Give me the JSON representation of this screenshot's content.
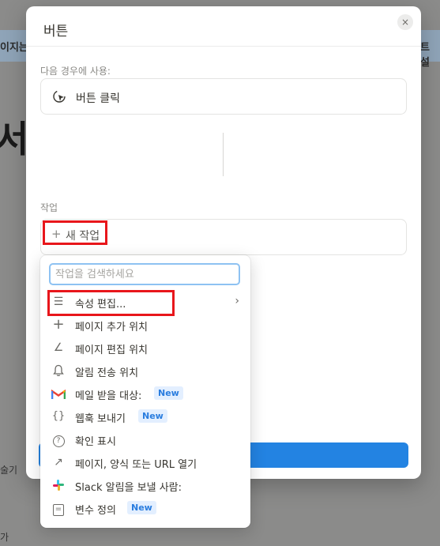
{
  "background": {
    "left_partial": "이지는",
    "right_partial": "트 설",
    "big_char": "서",
    "lower_left_partial": "술기",
    "bottom_left_partial": "가"
  },
  "modal": {
    "title": "버튼",
    "close_glyph": "×",
    "trigger_label": "다음 경우에 사용:",
    "trigger_value": "버튼 클릭",
    "action_label": "작업",
    "new_action_plus": "+",
    "new_action_label": "새 작업"
  },
  "dropdown": {
    "search_placeholder": "작업을 검색하세요",
    "items": [
      {
        "label": "속성 편집...",
        "icon": "list-icon",
        "glyph": "☰",
        "has_submenu": true,
        "badge": ""
      },
      {
        "label": "페이지 추가 위치",
        "icon": "plus-icon",
        "glyph": "+",
        "has_submenu": false,
        "badge": ""
      },
      {
        "label": "페이지 편집 위치",
        "icon": "edit-angle-icon",
        "glyph": "∠",
        "has_submenu": false,
        "badge": ""
      },
      {
        "label": "알림 전송 위치",
        "icon": "bell-icon",
        "glyph": "🔔︎",
        "has_submenu": false,
        "badge": ""
      },
      {
        "label": "메일 받을 대상:",
        "icon": "gmail-icon",
        "glyph": "M",
        "has_submenu": false,
        "badge": "New"
      },
      {
        "label": "웹훅 보내기",
        "icon": "braces-icon",
        "glyph": "{}",
        "has_submenu": false,
        "badge": "New"
      },
      {
        "label": "확인 표시",
        "icon": "question-circle-icon",
        "glyph": "?",
        "has_submenu": false,
        "badge": ""
      },
      {
        "label": "페이지, 양식 또는 URL 열기",
        "icon": "arrow-up-right-icon",
        "glyph": "↗",
        "has_submenu": false,
        "badge": ""
      },
      {
        "label": "Slack 알림을 보낼 사람:",
        "icon": "slack-icon",
        "glyph": "#",
        "has_submenu": false,
        "badge": ""
      },
      {
        "label": "변수 정의",
        "icon": "variable-icon",
        "glyph": "=",
        "has_submenu": false,
        "badge": "New"
      }
    ],
    "chevron_glyph": "›"
  },
  "colors": {
    "accent": "#2383e2",
    "highlight": "#e8161b",
    "badge_bg": "#e3efff",
    "badge_text": "#2a7ddf"
  }
}
